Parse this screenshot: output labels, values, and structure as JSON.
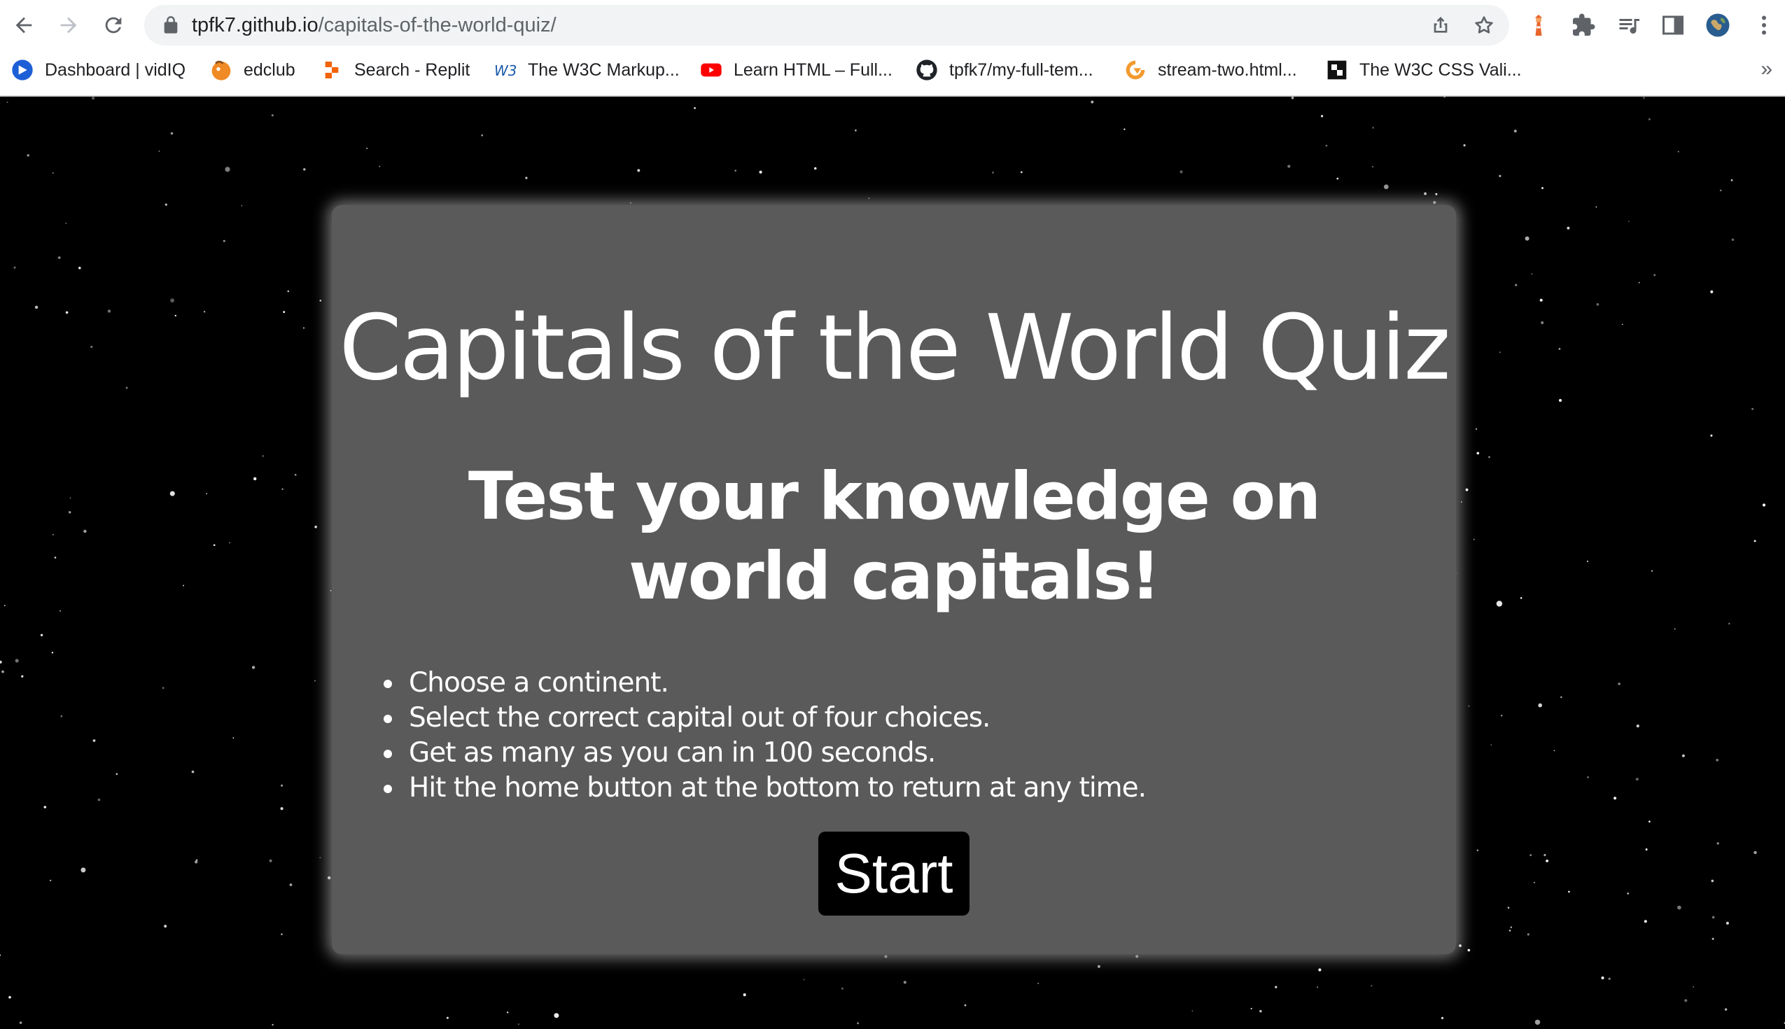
{
  "browser": {
    "url_host": "tpfk7.github.io",
    "url_path": "/capitals-of-the-world-quiz/",
    "bookmarks": [
      {
        "label": "Dashboard | vidIQ",
        "icon": "vidiq-icon"
      },
      {
        "label": "edclub",
        "icon": "edclub-icon"
      },
      {
        "label": "Search - Replit",
        "icon": "replit-icon"
      },
      {
        "label": "The W3C Markup...",
        "icon": "w3c-icon"
      },
      {
        "label": "Learn HTML – Full...",
        "icon": "youtube-icon"
      },
      {
        "label": "tpfk7/my-full-tem...",
        "icon": "github-icon"
      },
      {
        "label": "stream-two.html...",
        "icon": "codeanywhere-icon"
      },
      {
        "label": "The W3C CSS Vali...",
        "icon": "w3c-css-icon"
      }
    ],
    "bookmarks_more": "»"
  },
  "quiz": {
    "title": "Capitals of the World Quiz",
    "subtitle": "Test your knowledge on world capitals!",
    "rules": [
      "Choose a continent.",
      "Select the correct capital out of four choices.",
      "Get as many as you can in 100 seconds.",
      "Hit the home button at the bottom to return at any time."
    ],
    "start_label": "Start"
  },
  "colors": {
    "page_background": "#000000",
    "card_background": "#5a5a5a",
    "text": "#ffffff",
    "button_background": "#000000"
  }
}
